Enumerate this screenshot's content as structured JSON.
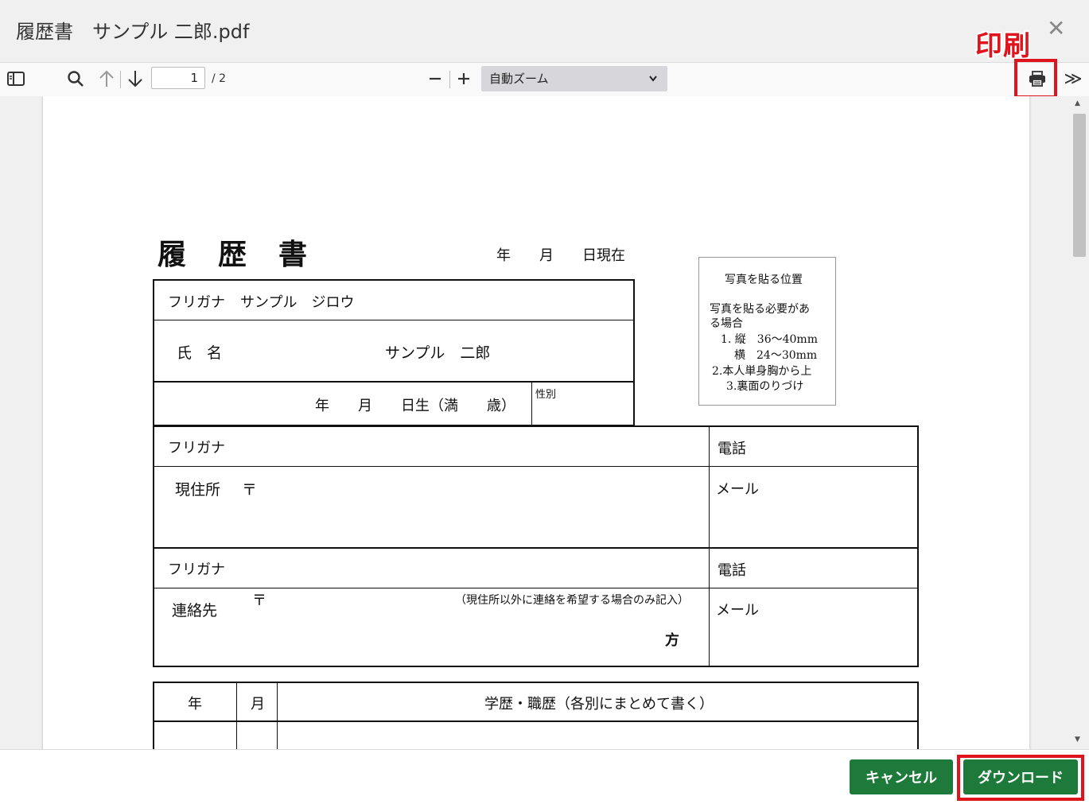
{
  "window": {
    "title": "履歴書　サンプル 二郎.pdf",
    "close_label": "✕",
    "annotation_label": "印刷"
  },
  "toolbar": {
    "current_page": "1",
    "page_count": "/ 2",
    "zoom_label": "自動ズーム",
    "zoom_chevron": "⌄",
    "more_label": "≫"
  },
  "document": {
    "heading": "履　歴　書",
    "date_as_of": "年　　月　　日現在",
    "photo_box": {
      "title": "写真を貼る位置",
      "line1": "写真を貼る必要があ",
      "line2": "る場合",
      "line3": "1. 縦　36～40mm",
      "line4": "横　24～30mm",
      "line5": "2.本人単身胸から上",
      "line6": "3.裏面のりづけ"
    },
    "furigana_label": "フリガナ",
    "furigana_value": "サンプル　ジロウ",
    "name_label": "氏　名",
    "name_value": "サンプル　二郎",
    "birth_label": "年　　月　　日生（満　　歳）",
    "gender_label": "性別",
    "address": {
      "furigana_label": "フリガナ",
      "phone_label": "電話",
      "current_label": "現住所",
      "postal_mark": "〒",
      "mail_label": "メール"
    },
    "contact": {
      "furigana_label": "フリガナ",
      "phone_label": "電話",
      "label": "連絡先",
      "postal_mark": "〒",
      "note": "（現住所以外に連絡を希望する場合のみ記入）",
      "suffix": "方",
      "mail_label": "メール"
    },
    "history": {
      "year_header": "年",
      "month_header": "月",
      "content_header": "学歴・職歴（各別にまとめて書く）"
    }
  },
  "footer": {
    "cancel_label": "キャンセル",
    "download_label": "ダウンロード"
  },
  "colors": {
    "button_green": "#1e7a3a",
    "highlight_red": "#e0141c"
  }
}
